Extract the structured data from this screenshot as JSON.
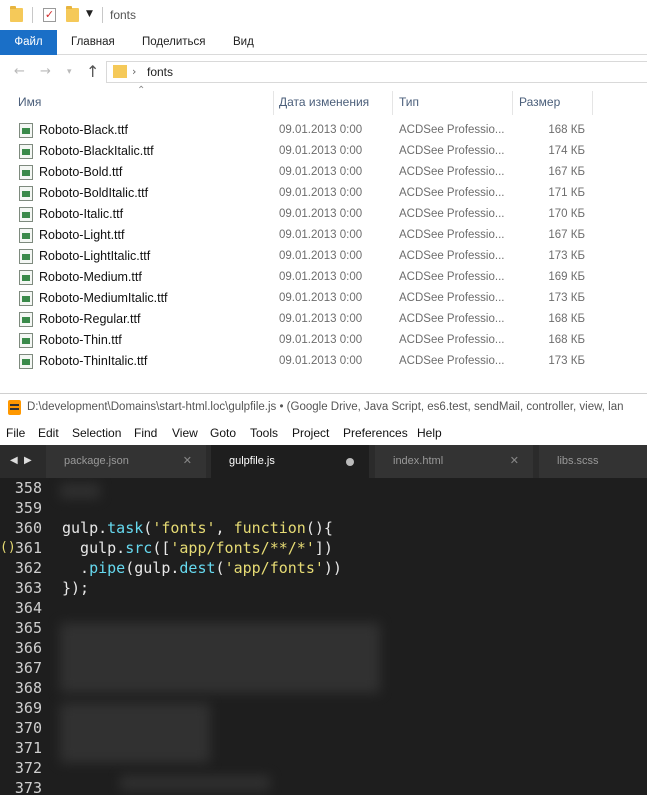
{
  "explorer": {
    "qat_title": "fonts",
    "ribbon_tabs": [
      "Файл",
      "Главная",
      "Поделиться",
      "Вид"
    ],
    "address_path": "fonts",
    "columns": [
      "Имя",
      "Дата изменения",
      "Тип",
      "Размер"
    ],
    "files": [
      {
        "name": "Roboto-Black.ttf",
        "date": "09.01.2013 0:00",
        "type": "ACDSee Professio...",
        "size": "168 КБ"
      },
      {
        "name": "Roboto-BlackItalic.ttf",
        "date": "09.01.2013 0:00",
        "type": "ACDSee Professio...",
        "size": "174 КБ"
      },
      {
        "name": "Roboto-Bold.ttf",
        "date": "09.01.2013 0:00",
        "type": "ACDSee Professio...",
        "size": "167 КБ"
      },
      {
        "name": "Roboto-BoldItalic.ttf",
        "date": "09.01.2013 0:00",
        "type": "ACDSee Professio...",
        "size": "171 КБ"
      },
      {
        "name": "Roboto-Italic.ttf",
        "date": "09.01.2013 0:00",
        "type": "ACDSee Professio...",
        "size": "170 КБ"
      },
      {
        "name": "Roboto-Light.ttf",
        "date": "09.01.2013 0:00",
        "type": "ACDSee Professio...",
        "size": "167 КБ"
      },
      {
        "name": "Roboto-LightItalic.ttf",
        "date": "09.01.2013 0:00",
        "type": "ACDSee Professio...",
        "size": "173 КБ"
      },
      {
        "name": "Roboto-Medium.ttf",
        "date": "09.01.2013 0:00",
        "type": "ACDSee Professio...",
        "size": "169 КБ"
      },
      {
        "name": "Roboto-MediumItalic.ttf",
        "date": "09.01.2013 0:00",
        "type": "ACDSee Professio...",
        "size": "173 КБ"
      },
      {
        "name": "Roboto-Regular.ttf",
        "date": "09.01.2013 0:00",
        "type": "ACDSee Professio...",
        "size": "168 КБ"
      },
      {
        "name": "Roboto-Thin.ttf",
        "date": "09.01.2013 0:00",
        "type": "ACDSee Professio...",
        "size": "168 КБ"
      },
      {
        "name": "Roboto-ThinItalic.ttf",
        "date": "09.01.2013 0:00",
        "type": "ACDSee Professio...",
        "size": "173 КБ"
      }
    ]
  },
  "sublime": {
    "window_title": "D:\\development\\Domains\\start-html.loc\\gulpfile.js • (Google Drive, Java Script, es6.test, sendMail, controller, view, lan",
    "menu": [
      "File",
      "Edit",
      "Selection",
      "Find",
      "View",
      "Goto",
      "Tools",
      "Project",
      "Preferences",
      "Help"
    ],
    "tabs": [
      {
        "label": "package.json",
        "active": false,
        "dirty": false
      },
      {
        "label": "gulpfile.js",
        "active": true,
        "dirty": true
      },
      {
        "label": "index.html",
        "active": false,
        "dirty": false
      },
      {
        "label": "libs.scss",
        "active": false,
        "dirty": false
      }
    ],
    "lines": [
      {
        "num": "358",
        "code": ""
      },
      {
        "num": "359",
        "code": ""
      },
      {
        "num": "360",
        "code": "gulp.task('fonts', function(){"
      },
      {
        "num": "361",
        "code": "  gulp.src(['app/fonts/**/*'])"
      },
      {
        "num": "362",
        "code": "  .pipe(gulp.dest('app/fonts'))"
      },
      {
        "num": "363",
        "code": "});"
      },
      {
        "num": "364",
        "code": ""
      },
      {
        "num": "365",
        "code": ""
      },
      {
        "num": "366",
        "code": ""
      },
      {
        "num": "367",
        "code": ""
      },
      {
        "num": "368",
        "code": ""
      },
      {
        "num": "369",
        "code": ""
      },
      {
        "num": "370",
        "code": ""
      },
      {
        "num": "371",
        "code": ""
      },
      {
        "num": "372",
        "code": ""
      },
      {
        "num": "373",
        "code": ""
      }
    ],
    "gutter_marker": "()",
    "colors": {
      "function": "#66d9ef",
      "string": "#e6db74",
      "call": "#a6e22e"
    }
  }
}
